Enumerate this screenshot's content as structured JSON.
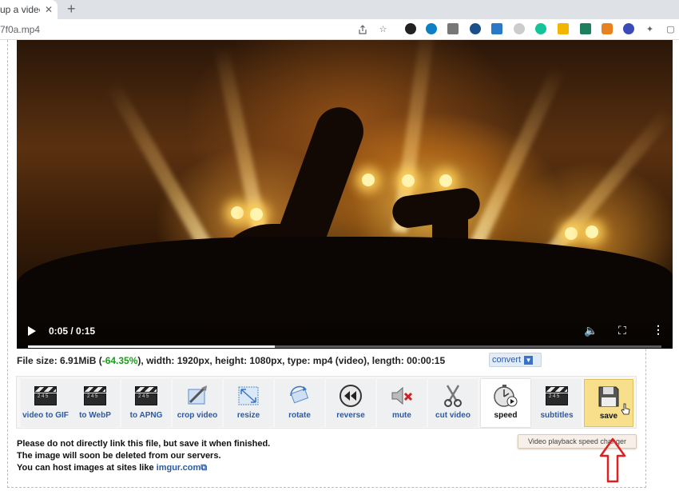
{
  "browser": {
    "tab_title": "up a video",
    "tab_close": "✕",
    "new_tab": "+",
    "url": "7f0a.mp4"
  },
  "video": {
    "time": "0:05 / 0:15",
    "progress_fraction": 0.39
  },
  "file_info": {
    "prefix": "File size: 6.91MiB (",
    "percent": "-64.35%",
    "suffix": "), width: 1920px, height: 1080px, type: mp4 (video), length: 00:00:15",
    "convert_label": "convert"
  },
  "tools": [
    {
      "label": "video to GIF",
      "name": "video-to-gif",
      "icon": "clapperboard"
    },
    {
      "label": "to WebP",
      "name": "to-webp",
      "icon": "clapperboard"
    },
    {
      "label": "to APNG",
      "name": "to-apng",
      "icon": "clapperboard"
    },
    {
      "label": "crop video",
      "name": "crop-video",
      "icon": "crop"
    },
    {
      "label": "resize",
      "name": "resize",
      "icon": "resize"
    },
    {
      "label": "rotate",
      "name": "rotate",
      "icon": "rotate"
    },
    {
      "label": "reverse",
      "name": "reverse",
      "icon": "rewind"
    },
    {
      "label": "mute",
      "name": "mute",
      "icon": "speaker-muted"
    },
    {
      "label": "cut video",
      "name": "cut-video",
      "icon": "scissors"
    },
    {
      "label": "speed",
      "name": "speed",
      "icon": "stopwatch"
    },
    {
      "label": "subtitles",
      "name": "subtitles",
      "icon": "clapperboard"
    },
    {
      "label": "save",
      "name": "save",
      "icon": "floppy-disk"
    }
  ],
  "notice": {
    "line1": "Please do not directly link this file, but save it when finished.",
    "line2": "The image will soon be deleted from our servers.",
    "line3_prefix": "You can host images at sites like ",
    "line3_link": "imgur.com"
  },
  "tooltip": "Video playback speed changer",
  "colors": {
    "link_blue": "#2a5aa8",
    "percent_green": "#1a9b1a",
    "save_bg": "#f7df8b",
    "arrow_red": "#e02020"
  }
}
